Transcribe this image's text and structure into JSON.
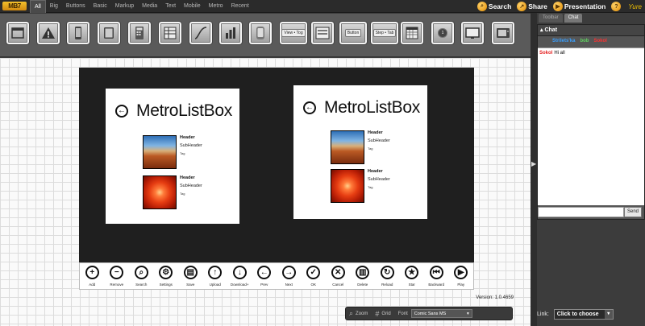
{
  "app": {
    "logo": "MB7"
  },
  "categories": [
    "All",
    "Big",
    "Buttons",
    "Basic",
    "Markup",
    "Media",
    "Text",
    "Mobile",
    "Metro",
    "Recent"
  ],
  "top_actions": {
    "search": "Search",
    "share": "Share",
    "presentation": "Presentation",
    "help": "?",
    "user": "Yure"
  },
  "toolbar_icons": [
    {
      "name": "window-icon"
    },
    {
      "name": "warning-icon"
    },
    {
      "name": "phone-icon"
    },
    {
      "name": "tablet-icon"
    },
    {
      "name": "calculator-icon"
    },
    {
      "name": "spreadsheet-icon"
    },
    {
      "name": "curve-icon"
    },
    {
      "name": "bar-chart-icon"
    },
    {
      "name": "phone-silver-icon"
    },
    {
      "name": "view-toggle-icon",
      "label": "View • Tog"
    },
    {
      "name": "form-icon"
    },
    {
      "name": "button-icon",
      "label": "Button"
    },
    {
      "name": "segmented-icon",
      "label": "Step • Tab"
    },
    {
      "name": "calendar-icon"
    },
    {
      "name": "badge-icon",
      "label": "1"
    },
    {
      "name": "monitor-icon"
    },
    {
      "name": "tv-icon"
    }
  ],
  "right_panel": {
    "tabs": [
      "Toolbar",
      "Chat"
    ],
    "chat_title": "Chat",
    "users": [
      {
        "name": "Strilets'ka",
        "color": "#3aa0ff"
      },
      {
        "name": "bob",
        "color": "#5fd15f"
      },
      {
        "name": "Sokol",
        "color": "#ff3030"
      }
    ],
    "messages": [
      {
        "author": "Sokol",
        "text": "Hi all"
      }
    ],
    "send_label": "Send",
    "link_label": "Link:",
    "link_select": "Click to choose"
  },
  "mockup": {
    "left_panel": {
      "title": "MetroListBox",
      "items": [
        {
          "header": "Header",
          "sub": "SubHeader",
          "tag": "Tag",
          "image": "canyon"
        },
        {
          "header": "Header",
          "sub": "SubHeader",
          "tag": "Tag",
          "image": "flower"
        }
      ]
    },
    "right_panel": {
      "title": "MetroListBox",
      "items": [
        {
          "header": "Header",
          "sub": "SubHeader",
          "tag": "Tag",
          "image": "canyon"
        },
        {
          "header": "Header",
          "sub": "SubHeader",
          "tag": "Tag",
          "image": "flower"
        }
      ]
    },
    "appbar": [
      {
        "label": "Add",
        "icon": "plus-icon",
        "glyph": "+"
      },
      {
        "label": "Remove",
        "icon": "minus-icon",
        "glyph": "−"
      },
      {
        "label": "Search",
        "icon": "search-icon",
        "glyph": "⌕"
      },
      {
        "label": "Settings",
        "icon": "gear-icon",
        "glyph": "⚙"
      },
      {
        "label": "Save",
        "icon": "save-icon",
        "glyph": "▤"
      },
      {
        "label": "Upload",
        "icon": "upload-icon",
        "glyph": "↑"
      },
      {
        "label": "Download+",
        "icon": "download-icon",
        "glyph": "↓"
      },
      {
        "label": "Prev",
        "icon": "prev-icon",
        "glyph": "←"
      },
      {
        "label": "Next",
        "icon": "next-icon",
        "glyph": "→"
      },
      {
        "label": "OK",
        "icon": "check-icon",
        "glyph": "✓"
      },
      {
        "label": "Cancel",
        "icon": "cancel-icon",
        "glyph": "✕"
      },
      {
        "label": "Delete",
        "icon": "trash-icon",
        "glyph": "▥"
      },
      {
        "label": "Reload",
        "icon": "reload-icon",
        "glyph": "↻"
      },
      {
        "label": "Star",
        "icon": "star-icon",
        "glyph": "★"
      },
      {
        "label": "Backward",
        "icon": "backward-icon",
        "glyph": "⏮"
      },
      {
        "label": "Play",
        "icon": "play-icon",
        "glyph": "▶"
      }
    ]
  },
  "version": "Version: 1.0.4659",
  "bottom_bar": {
    "zoom": "Zoom",
    "grid": "Grid",
    "font_label": "Font",
    "font_value": "Comic Sans MS"
  }
}
